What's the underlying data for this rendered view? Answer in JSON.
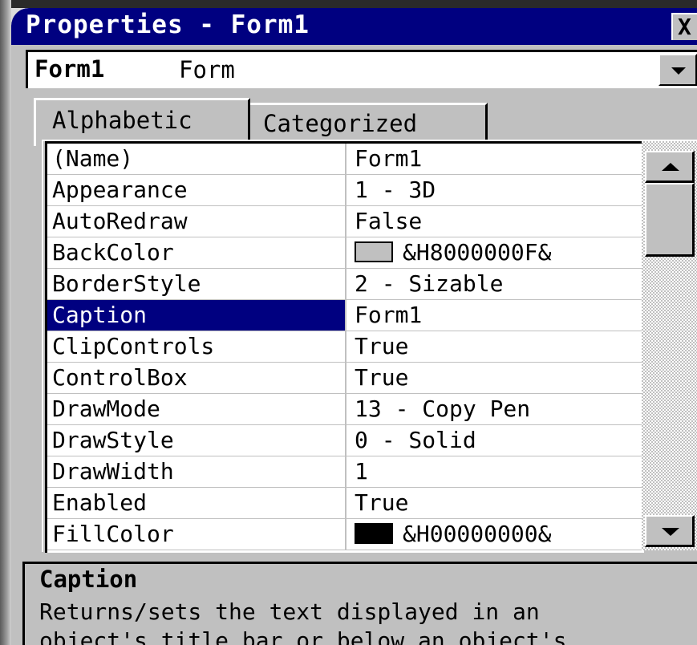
{
  "window": {
    "title": "Properties - Form1",
    "close_label": "X"
  },
  "object_selector": {
    "name": "Form1",
    "type": "Form"
  },
  "tabs": [
    {
      "label": "Alphabetic",
      "active": true
    },
    {
      "label": "Categorized",
      "active": false
    }
  ],
  "properties": [
    {
      "name": "(Name)",
      "value": "Form1"
    },
    {
      "name": "Appearance",
      "value": "1 - 3D"
    },
    {
      "name": "AutoRedraw",
      "value": "False"
    },
    {
      "name": "BackColor",
      "value": "&H8000000F&",
      "swatch": "#c0c0c0"
    },
    {
      "name": "BorderStyle",
      "value": "2 - Sizable"
    },
    {
      "name": "Caption",
      "value": "Form1",
      "selected": true
    },
    {
      "name": "ClipControls",
      "value": "True"
    },
    {
      "name": "ControlBox",
      "value": "True"
    },
    {
      "name": "DrawMode",
      "value": "13 - Copy Pen"
    },
    {
      "name": "DrawStyle",
      "value": "0 - Solid"
    },
    {
      "name": "DrawWidth",
      "value": "1"
    },
    {
      "name": "Enabled",
      "value": "True"
    },
    {
      "name": "FillColor",
      "value": "&H00000000&",
      "swatch": "#000000"
    }
  ],
  "description": {
    "title": "Caption",
    "line1": "Returns/sets the text displayed in an",
    "line2": "object's title bar or below an object's"
  },
  "colors": {
    "titlebar": "#000080",
    "selection": "#000080",
    "face": "#c0c0c0"
  }
}
